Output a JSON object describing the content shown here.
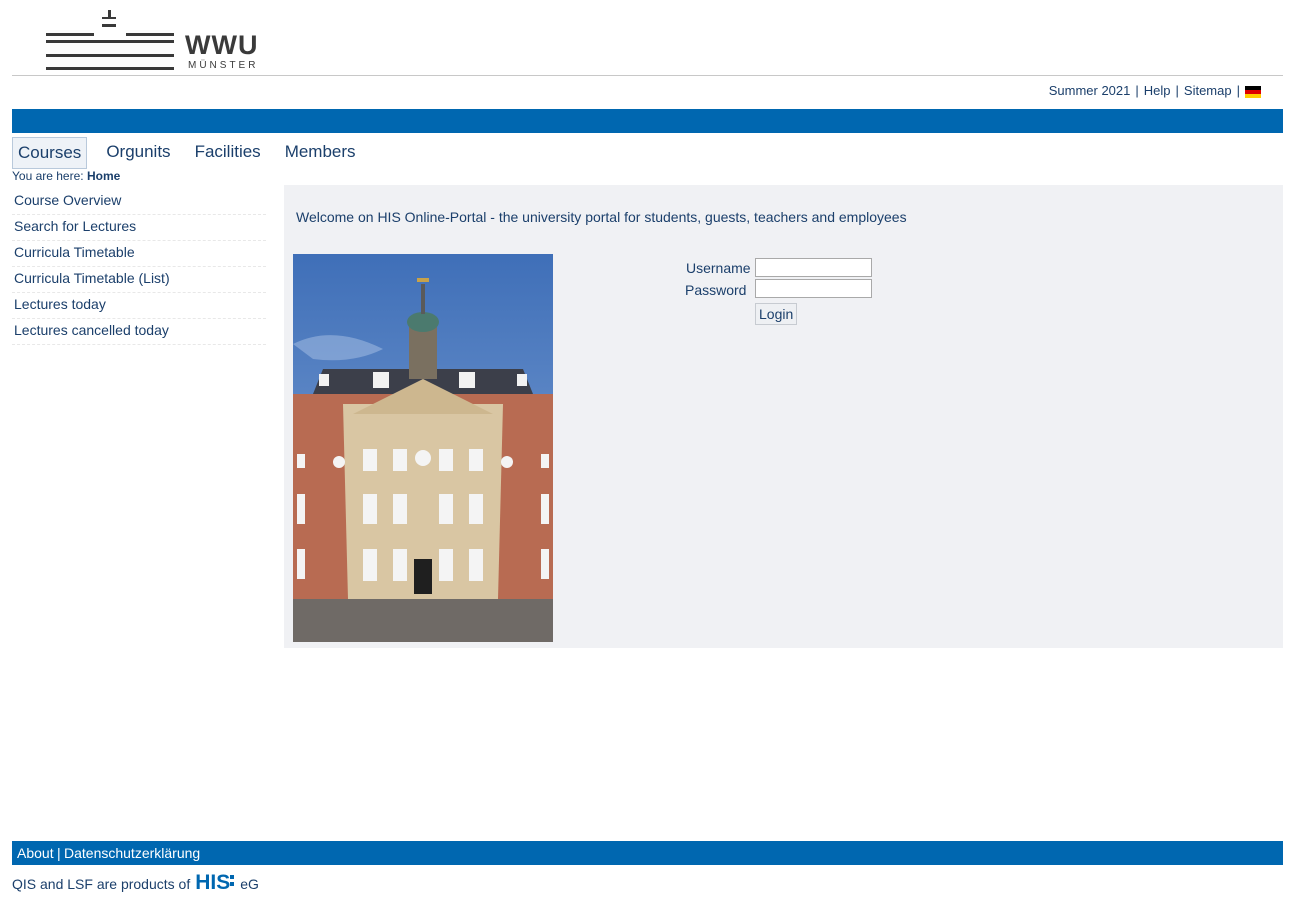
{
  "logo": {
    "wordmark": "WWU",
    "subtitle": "MÜNSTER"
  },
  "toplinks": {
    "semester": "Summer 2021",
    "help": "Help",
    "sitemap": "Sitemap",
    "language_flag_icon": "germany-flag-icon"
  },
  "tabs": [
    {
      "label": "Courses",
      "active": true
    },
    {
      "label": "Orgunits",
      "active": false
    },
    {
      "label": "Facilities",
      "active": false
    },
    {
      "label": "Members",
      "active": false
    }
  ],
  "breadcrumb": {
    "prefix": "You are here:",
    "current": "Home"
  },
  "sidebar": {
    "items": [
      {
        "label": "Course Overview"
      },
      {
        "label": "Search for Lectures"
      },
      {
        "label": "Curricula Timetable"
      },
      {
        "label": "Curricula Timetable (List)"
      },
      {
        "label": "Lectures today"
      },
      {
        "label": "Lectures cancelled today"
      }
    ]
  },
  "main": {
    "welcome": "Welcome on HIS Online-Portal - the university portal for students, guests, teachers and employees",
    "login": {
      "username_label": "Username",
      "password_label": "Password",
      "username_value": "",
      "password_value": "",
      "button": "Login"
    }
  },
  "footer": {
    "about": "About",
    "privacy": "Datenschutzerklärung",
    "separator": "|",
    "products_text": "QIS and LSF are products of",
    "his_logo": "HIS",
    "eg": "eG"
  },
  "colors": {
    "blue_bar": "#0067b0",
    "link": "#1b3f6b",
    "panel": "#f0f1f4"
  }
}
